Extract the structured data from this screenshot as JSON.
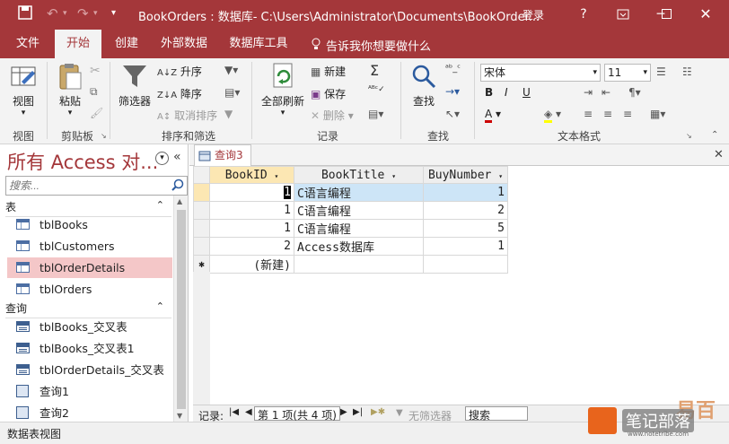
{
  "window": {
    "title": "BookOrders : 数据库- C:\\Users\\Administrator\\Documents\\BookOrder...",
    "login_label": "登录",
    "help_label": "?"
  },
  "ribbon_tabs": [
    "文件",
    "开始",
    "创建",
    "外部数据",
    "数据库工具"
  ],
  "tell_me": "告诉我你想要做什么",
  "ribbon": {
    "views": {
      "label": "视图",
      "button": "视图"
    },
    "clipboard": {
      "label": "剪贴板",
      "paste": "粘贴"
    },
    "sort_filter": {
      "label": "排序和筛选",
      "filter": "筛选器",
      "ascending": "升序",
      "descending": "降序",
      "remove_sort": "取消排序"
    },
    "records": {
      "label": "记录",
      "refresh_all": "全部刷新",
      "new": "新建",
      "save": "保存",
      "delete": "删除"
    },
    "find": {
      "label": "查找",
      "find": "查找"
    },
    "text_format": {
      "label": "文本格式",
      "font": "宋体",
      "font_size": "11"
    }
  },
  "nav_pane": {
    "title": "所有 Access 对...",
    "search_placeholder": "搜索...",
    "categories": [
      {
        "name": "表",
        "items": [
          "tblBooks",
          "tblCustomers",
          "tblOrderDetails",
          "tblOrders"
        ]
      },
      {
        "name": "查询",
        "items": [
          "tblBooks_交叉表",
          "tblBooks_交叉表1",
          "tblOrderDetails_交叉表",
          "查询1",
          "查询2"
        ]
      }
    ],
    "selected_item": "tblOrderDetails"
  },
  "document_tab": "查询3",
  "datasheet": {
    "columns": [
      "BookID",
      "BookTitle",
      "BuyNumber"
    ],
    "rows": [
      [
        "1",
        "C语言编程",
        "1"
      ],
      [
        "1",
        "C语言编程",
        "2"
      ],
      [
        "1",
        "C语言编程",
        "5"
      ],
      [
        "2",
        "Access数据库",
        "1"
      ]
    ],
    "new_row_label": "(新建)",
    "new_row_marker": "✱"
  },
  "record_nav": {
    "label": "记录:",
    "position": "第 1 项(共 4 项)",
    "filter": "无筛选器",
    "search": "搜索"
  },
  "status_bar": {
    "text": "数据表视图"
  },
  "watermark": {
    "line1": "易百",
    "line2": "笔记部落",
    "url": "www.notetribe.com"
  },
  "colors": {
    "accent": "#a4373a",
    "selected_nav": "#f4c7c8",
    "header_highlight": "#fce7b3"
  }
}
